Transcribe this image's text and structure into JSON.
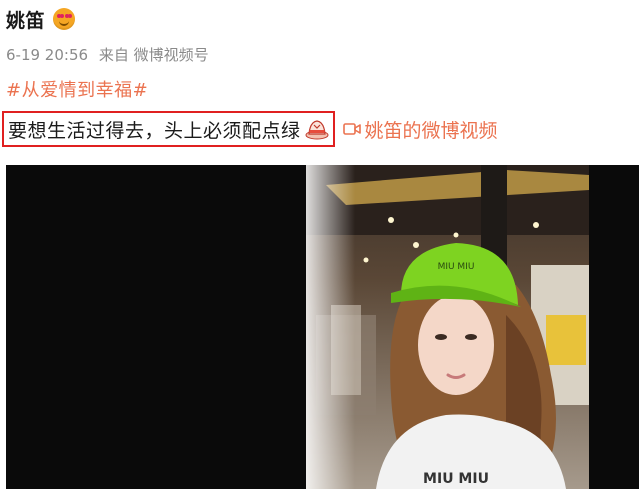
{
  "post": {
    "author": "姚笛",
    "emoji": "heart-eyes-emoji",
    "date": "6-19 20:56",
    "source_prefix": "来自",
    "source_client": "微博视频号",
    "topic": "#从爱情到幸福#",
    "text": "要想生活过得去，头上必须配点绿",
    "text_emoji": "hat-emoji",
    "video_link_label": "姚笛的微博视频"
  },
  "video": {
    "cap_text": "MIU MIU",
    "shirt_text": "MIU MIU",
    "highlight_color": "#e02020",
    "link_color": "#eb7350",
    "cap_color": "#7ed321"
  }
}
